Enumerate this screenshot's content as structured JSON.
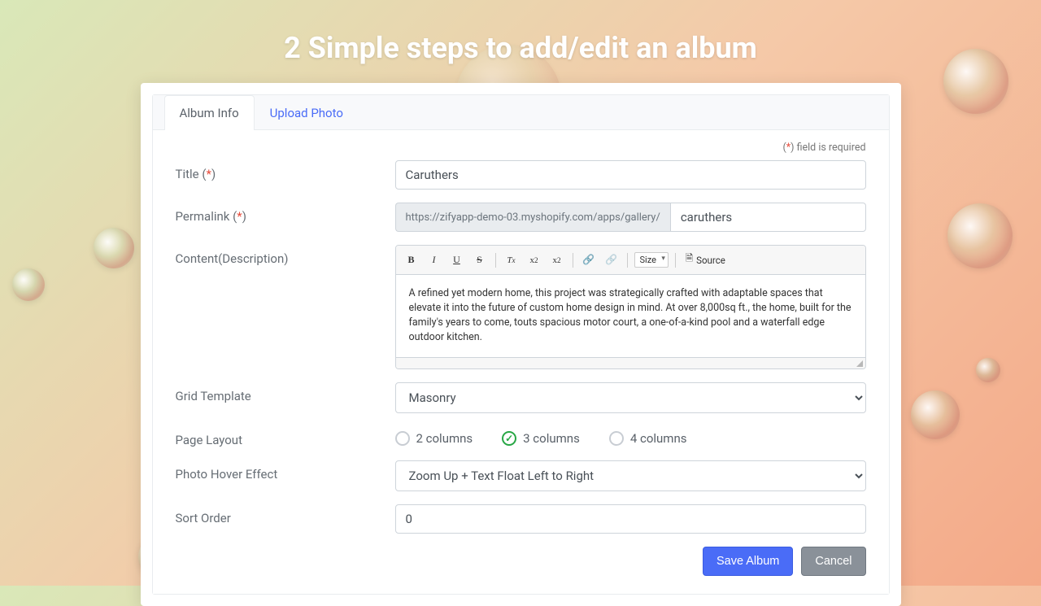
{
  "headline": "2 Simple steps to add/edit an album",
  "tabs": {
    "album_info": "Album Info",
    "upload_photo": "Upload Photo"
  },
  "required_note_prefix": "(",
  "required_note_star": "*",
  "required_note_suffix": ") field is required",
  "labels": {
    "title": "Title (",
    "title_star": "*",
    "title_close": ")",
    "permalink": "Permalink (",
    "permalink_star": "*",
    "permalink_close": ")",
    "content": "Content(Description)",
    "grid_template": "Grid Template",
    "page_layout": "Page Layout",
    "hover_effect": "Photo Hover Effect",
    "sort_order": "Sort Order"
  },
  "values": {
    "title": "Caruthers",
    "permalink_prefix": "https://zifyapp-demo-03.myshopify.com/apps/gallery/",
    "permalink_slug": "caruthers",
    "description": "A refined yet modern home, this project was strategically crafted with adaptable spaces that elevate it into the future of custom home design in mind. At over 8,000sq ft., the home, built for the family's years to come, touts spacious motor court, a one-of-a-kind pool and a waterfall edge outdoor kitchen.",
    "grid_template": "Masonry",
    "hover_effect": "Zoom Up + Text Float Left to Right",
    "sort_order": "0"
  },
  "editor_toolbar": {
    "size_label": "Size",
    "source_label": "Source"
  },
  "page_layout_options": {
    "col2": "2 columns",
    "col3": "3 columns",
    "col4": "4 columns",
    "selected": "col3"
  },
  "buttons": {
    "save": "Save Album",
    "cancel": "Cancel"
  }
}
